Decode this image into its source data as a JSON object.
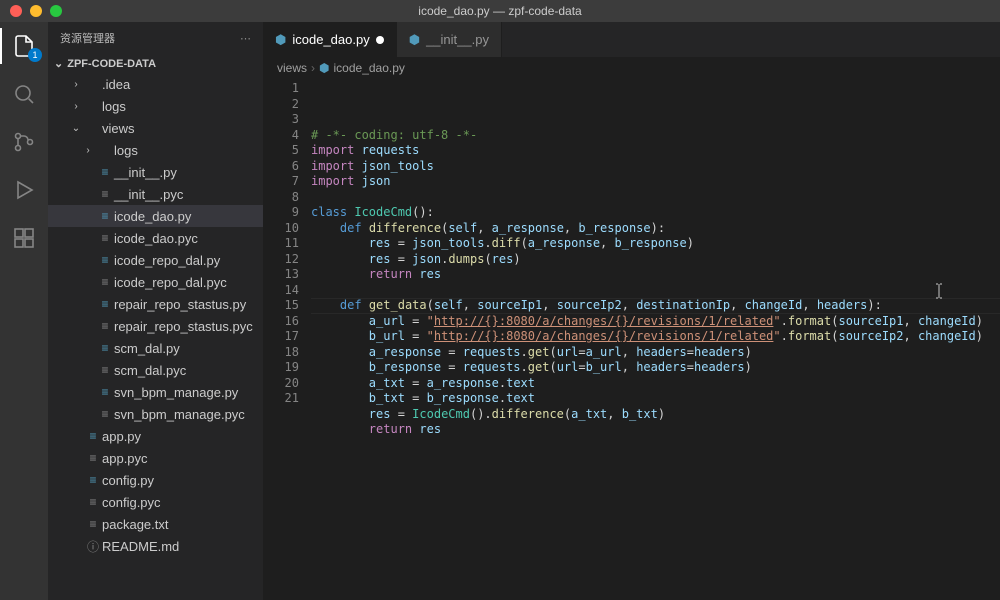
{
  "window": {
    "title": "icode_dao.py — zpf-code-data"
  },
  "sidebar": {
    "title": "资源管理器",
    "project": "ZPF-CODE-DATA",
    "tree": [
      {
        "name": ".idea",
        "kind": "folder",
        "depth": 1,
        "expanded": false
      },
      {
        "name": "logs",
        "kind": "folder",
        "depth": 1,
        "expanded": false
      },
      {
        "name": "views",
        "kind": "folder",
        "depth": 1,
        "expanded": true
      },
      {
        "name": "logs",
        "kind": "folder",
        "depth": 2,
        "expanded": false
      },
      {
        "name": "__init__.py",
        "kind": "py",
        "depth": 2
      },
      {
        "name": "__init__.pyc",
        "kind": "pyc",
        "depth": 2
      },
      {
        "name": "icode_dao.py",
        "kind": "py",
        "depth": 2,
        "selected": true
      },
      {
        "name": "icode_dao.pyc",
        "kind": "pyc",
        "depth": 2
      },
      {
        "name": "icode_repo_dal.py",
        "kind": "py",
        "depth": 2
      },
      {
        "name": "icode_repo_dal.pyc",
        "kind": "pyc",
        "depth": 2
      },
      {
        "name": "repair_repo_stastus.py",
        "kind": "py",
        "depth": 2
      },
      {
        "name": "repair_repo_stastus.pyc",
        "kind": "pyc",
        "depth": 2
      },
      {
        "name": "scm_dal.py",
        "kind": "py",
        "depth": 2
      },
      {
        "name": "scm_dal.pyc",
        "kind": "pyc",
        "depth": 2
      },
      {
        "name": "svn_bpm_manage.py",
        "kind": "py",
        "depth": 2
      },
      {
        "name": "svn_bpm_manage.pyc",
        "kind": "pyc",
        "depth": 2
      },
      {
        "name": "app.py",
        "kind": "py",
        "depth": 1
      },
      {
        "name": "app.pyc",
        "kind": "pyc",
        "depth": 1
      },
      {
        "name": "config.py",
        "kind": "py",
        "depth": 1
      },
      {
        "name": "config.pyc",
        "kind": "pyc",
        "depth": 1
      },
      {
        "name": "package.txt",
        "kind": "txt",
        "depth": 1
      },
      {
        "name": "README.md",
        "kind": "md",
        "depth": 1
      }
    ]
  },
  "activity": {
    "badge": "1"
  },
  "tabs": [
    {
      "label": "icode_dao.py",
      "active": true,
      "dirty": true,
      "icon": "py"
    },
    {
      "label": "__init__.py",
      "active": false,
      "dirty": false,
      "icon": "py"
    }
  ],
  "breadcrumbs": {
    "a": "views",
    "b": "icode_dao.py"
  },
  "code": {
    "lineCount": 21,
    "currentLine": 15,
    "lines": [
      [
        [
          "cmt",
          "# -*- coding: utf-8 -*-"
        ]
      ],
      [
        [
          "kw",
          "import"
        ],
        [
          "pln",
          " "
        ],
        [
          "var",
          "requests"
        ]
      ],
      [
        [
          "kw",
          "import"
        ],
        [
          "pln",
          " "
        ],
        [
          "var",
          "json_tools"
        ]
      ],
      [
        [
          "kw",
          "import"
        ],
        [
          "pln",
          " "
        ],
        [
          "var",
          "json"
        ]
      ],
      [],
      [
        [
          "kw2",
          "class"
        ],
        [
          "pln",
          " "
        ],
        [
          "cls",
          "IcodeCmd"
        ],
        [
          "pln",
          "():"
        ]
      ],
      [
        [
          "pln",
          "    "
        ],
        [
          "kw2",
          "def"
        ],
        [
          "pln",
          " "
        ],
        [
          "fn",
          "difference"
        ],
        [
          "pln",
          "("
        ],
        [
          "self",
          "self"
        ],
        [
          "pln",
          ", "
        ],
        [
          "var",
          "a_response"
        ],
        [
          "pln",
          ", "
        ],
        [
          "var",
          "b_response"
        ],
        [
          "pln",
          "):"
        ]
      ],
      [
        [
          "pln",
          "        "
        ],
        [
          "var",
          "res"
        ],
        [
          "pln",
          " = "
        ],
        [
          "var",
          "json_tools"
        ],
        [
          "pln",
          "."
        ],
        [
          "fn",
          "diff"
        ],
        [
          "pln",
          "("
        ],
        [
          "var",
          "a_response"
        ],
        [
          "pln",
          ", "
        ],
        [
          "var",
          "b_response"
        ],
        [
          "pln",
          ")"
        ]
      ],
      [
        [
          "pln",
          "        "
        ],
        [
          "var",
          "res"
        ],
        [
          "pln",
          " = "
        ],
        [
          "var",
          "json"
        ],
        [
          "pln",
          "."
        ],
        [
          "fn",
          "dumps"
        ],
        [
          "pln",
          "("
        ],
        [
          "var",
          "res"
        ],
        [
          "pln",
          ")"
        ]
      ],
      [
        [
          "pln",
          "        "
        ],
        [
          "kw",
          "return"
        ],
        [
          "pln",
          " "
        ],
        [
          "var",
          "res"
        ]
      ],
      [],
      [
        [
          "pln",
          "    "
        ],
        [
          "kw2",
          "def"
        ],
        [
          "pln",
          " "
        ],
        [
          "fn",
          "get_data"
        ],
        [
          "pln",
          "("
        ],
        [
          "self",
          "self"
        ],
        [
          "pln",
          ", "
        ],
        [
          "var",
          "sourceIp1"
        ],
        [
          "pln",
          ", "
        ],
        [
          "var",
          "sourceIp2"
        ],
        [
          "pln",
          ", "
        ],
        [
          "var",
          "destinationIp"
        ],
        [
          "pln",
          ", "
        ],
        [
          "var",
          "changeId"
        ],
        [
          "pln",
          ", "
        ],
        [
          "var",
          "headers"
        ],
        [
          "pln",
          "):"
        ]
      ],
      [
        [
          "pln",
          "        "
        ],
        [
          "var",
          "a_url"
        ],
        [
          "pln",
          " = "
        ],
        [
          "str",
          "\""
        ],
        [
          "url",
          "http://{}:8080/a/changes/{}/revisions/1/related"
        ],
        [
          "str",
          "\""
        ],
        [
          "pln",
          "."
        ],
        [
          "fn",
          "format"
        ],
        [
          "pln",
          "("
        ],
        [
          "var",
          "sourceIp1"
        ],
        [
          "pln",
          ", "
        ],
        [
          "var",
          "changeId"
        ],
        [
          "pln",
          ")"
        ]
      ],
      [
        [
          "pln",
          "        "
        ],
        [
          "var",
          "b_url"
        ],
        [
          "pln",
          " = "
        ],
        [
          "str",
          "\""
        ],
        [
          "url",
          "http://{}:8080/a/changes/{}/revisions/1/related"
        ],
        [
          "str",
          "\""
        ],
        [
          "pln",
          "."
        ],
        [
          "fn",
          "format"
        ],
        [
          "pln",
          "("
        ],
        [
          "var",
          "sourceIp2"
        ],
        [
          "pln",
          ", "
        ],
        [
          "var",
          "changeId"
        ],
        [
          "pln",
          ")"
        ]
      ],
      [
        [
          "pln",
          "        "
        ],
        [
          "var",
          "a_response"
        ],
        [
          "pln",
          " = "
        ],
        [
          "var",
          "requests"
        ],
        [
          "pln",
          "."
        ],
        [
          "fn",
          "get"
        ],
        [
          "pln",
          "("
        ],
        [
          "var",
          "url"
        ],
        [
          "pln",
          "="
        ],
        [
          "var",
          "a_url"
        ],
        [
          "pln",
          ", "
        ],
        [
          "var",
          "headers"
        ],
        [
          "pln",
          "="
        ],
        [
          "var",
          "headers"
        ],
        [
          "pln",
          ")"
        ]
      ],
      [
        [
          "pln",
          "        "
        ],
        [
          "var",
          "b_response"
        ],
        [
          "pln",
          " = "
        ],
        [
          "var",
          "requests"
        ],
        [
          "pln",
          "."
        ],
        [
          "fn",
          "get"
        ],
        [
          "pln",
          "("
        ],
        [
          "var",
          "url"
        ],
        [
          "pln",
          "="
        ],
        [
          "var",
          "b_url"
        ],
        [
          "pln",
          ", "
        ],
        [
          "var",
          "headers"
        ],
        [
          "pln",
          "="
        ],
        [
          "var",
          "headers"
        ],
        [
          "pln",
          ")"
        ]
      ],
      [
        [
          "pln",
          "        "
        ],
        [
          "var",
          "a_txt"
        ],
        [
          "pln",
          " = "
        ],
        [
          "var",
          "a_response"
        ],
        [
          "pln",
          "."
        ],
        [
          "var",
          "text"
        ]
      ],
      [
        [
          "pln",
          "        "
        ],
        [
          "var",
          "b_txt"
        ],
        [
          "pln",
          " = "
        ],
        [
          "var",
          "b_response"
        ],
        [
          "pln",
          "."
        ],
        [
          "var",
          "text"
        ]
      ],
      [
        [
          "pln",
          "        "
        ],
        [
          "var",
          "res"
        ],
        [
          "pln",
          " = "
        ],
        [
          "cls",
          "IcodeCmd"
        ],
        [
          "pln",
          "()."
        ],
        [
          "fn",
          "difference"
        ],
        [
          "pln",
          "("
        ],
        [
          "var",
          "a_txt"
        ],
        [
          "pln",
          ", "
        ],
        [
          "var",
          "b_txt"
        ],
        [
          "pln",
          ")"
        ]
      ],
      [
        [
          "pln",
          "        "
        ],
        [
          "kw",
          "return"
        ],
        [
          "pln",
          " "
        ],
        [
          "var",
          "res"
        ]
      ],
      []
    ]
  }
}
